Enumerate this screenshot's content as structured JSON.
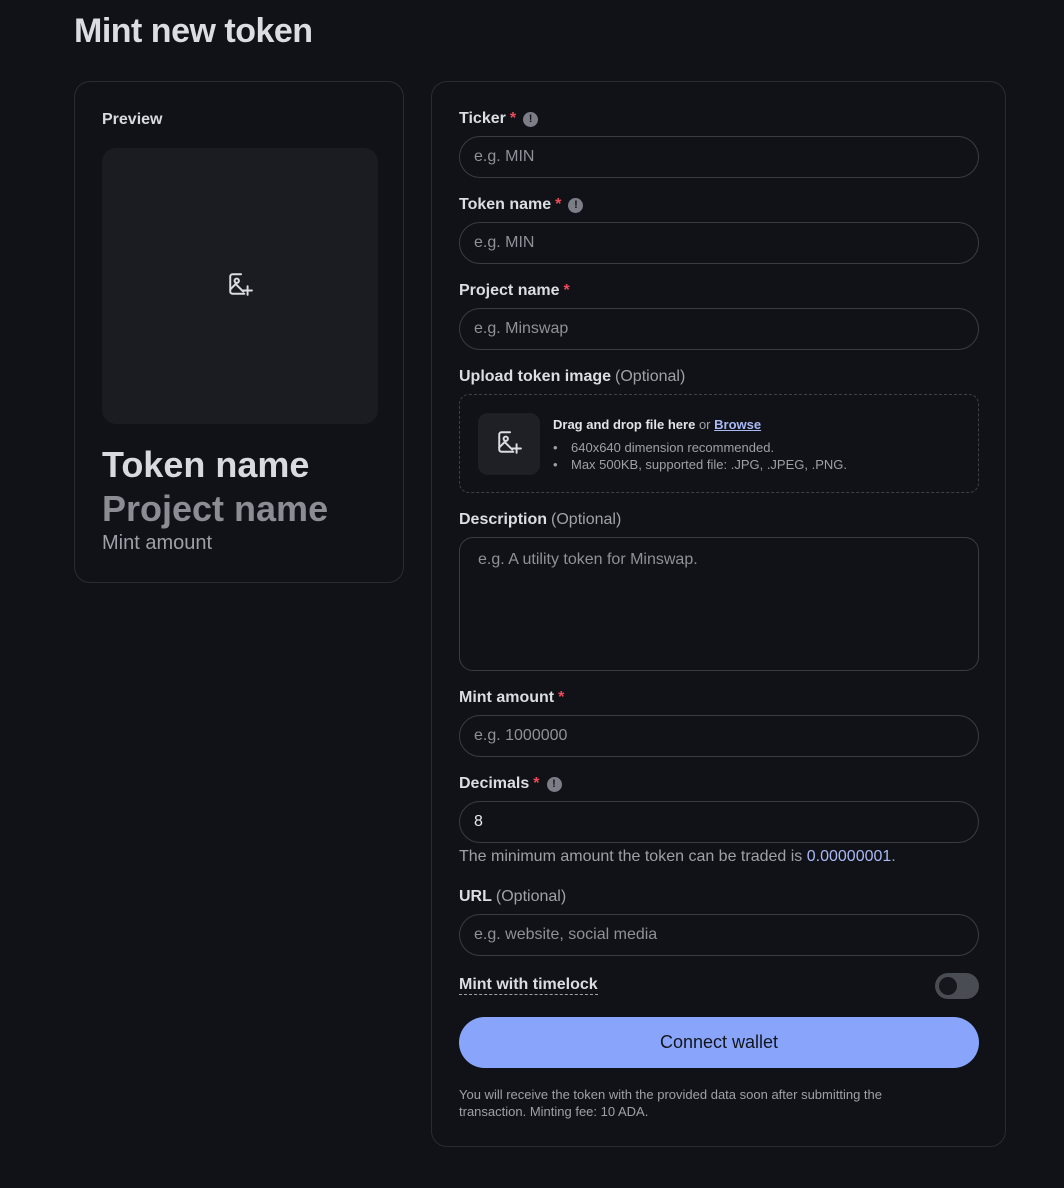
{
  "page": {
    "title": "Mint new token"
  },
  "preview": {
    "label": "Preview",
    "image_icon": "image-plus-icon",
    "token_name": "Token name",
    "project_name": "Project name",
    "mint_amount": "Mint amount"
  },
  "form": {
    "ticker": {
      "label": "Ticker",
      "required": "*",
      "placeholder": "e.g. MIN",
      "value": ""
    },
    "token_name": {
      "label": "Token name",
      "required": "*",
      "placeholder": "e.g. MIN",
      "value": ""
    },
    "project_name": {
      "label": "Project name",
      "required": "*",
      "placeholder": "e.g. Minswap",
      "value": ""
    },
    "upload": {
      "label": "Upload token image",
      "optional": "(Optional)",
      "title": "Drag and drop file here",
      "or": "or",
      "browse": "Browse",
      "hints": [
        "640x640 dimension recommended.",
        "Max 500KB, supported file: .JPG, .JPEG, .PNG."
      ]
    },
    "description": {
      "label": "Description",
      "optional": "(Optional)",
      "placeholder": "e.g. A utility token for Minswap.",
      "value": ""
    },
    "mint_amount": {
      "label": "Mint amount",
      "required": "*",
      "placeholder": "e.g. 1000000",
      "value": ""
    },
    "decimals": {
      "label": "Decimals",
      "required": "*",
      "value": "8",
      "helper_prefix": "The minimum amount the token can be traded is",
      "helper_value": "0.00000001",
      "helper_suffix": "."
    },
    "url": {
      "label": "URL",
      "optional": "(Optional)",
      "placeholder": "e.g. website, social media",
      "value": ""
    },
    "timelock": {
      "label": "Mint with timelock",
      "enabled": false
    },
    "connect_button": "Connect wallet",
    "footnote": "You will receive the token with the provided data soon after submitting the transaction. Minting fee: 10 ADA."
  },
  "colors": {
    "accent": "#89a5fb",
    "required": "#ef4b5a",
    "link": "#a9b9f5",
    "background": "#111217"
  }
}
